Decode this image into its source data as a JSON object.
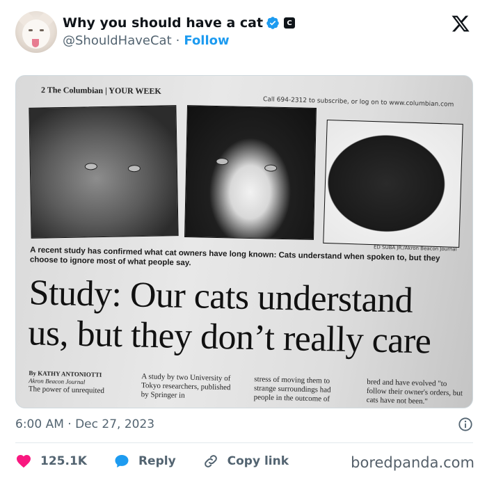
{
  "author": {
    "display_name": "Why you should have a cat",
    "handle": "@ShouldHaveCat",
    "follow_label": "Follow",
    "separator": "·",
    "verified_icon": "verified-badge-icon",
    "org_badge_letter": "C"
  },
  "platform_logo": "x-logo-icon",
  "media": {
    "newspaper_header": "2  The Columbian | YOUR WEEK",
    "newspaper_header_right": "Call 694-2312 to subscribe, or log on to www.columbian.com",
    "photo_credit": "ED SUBA JR./Akron Beacon Journal",
    "caption": "A recent study has confirmed what cat owners have long known: Cats understand when spoken to, but they choose to ignore most of what people say.",
    "headline_line1": "Study: Our cats understand",
    "headline_line2": "us, but they don’t really care",
    "byline_name": "By KATHY ANTONIOTTI",
    "byline_outlet": "Akron Beacon Journal",
    "col1": "The power of unrequited",
    "col2": "A study by two University of Tokyo researchers, published by Springer in",
    "col3": "stress of moving them to strange surroundings had people in the outcome of",
    "col4": "bred and have evolved \"to follow their owner's orders, but cats have not been.\""
  },
  "timestamp": "6:00 AM · Dec 27, 2023",
  "actions": {
    "like_count": "125.1K",
    "reply_label": "Reply",
    "copy_link_label": "Copy link"
  },
  "watermark": "boredpanda.com",
  "colors": {
    "accent": "#1d9bf0",
    "like": "#f91880",
    "text": "#0f1419",
    "muted": "#536471"
  }
}
